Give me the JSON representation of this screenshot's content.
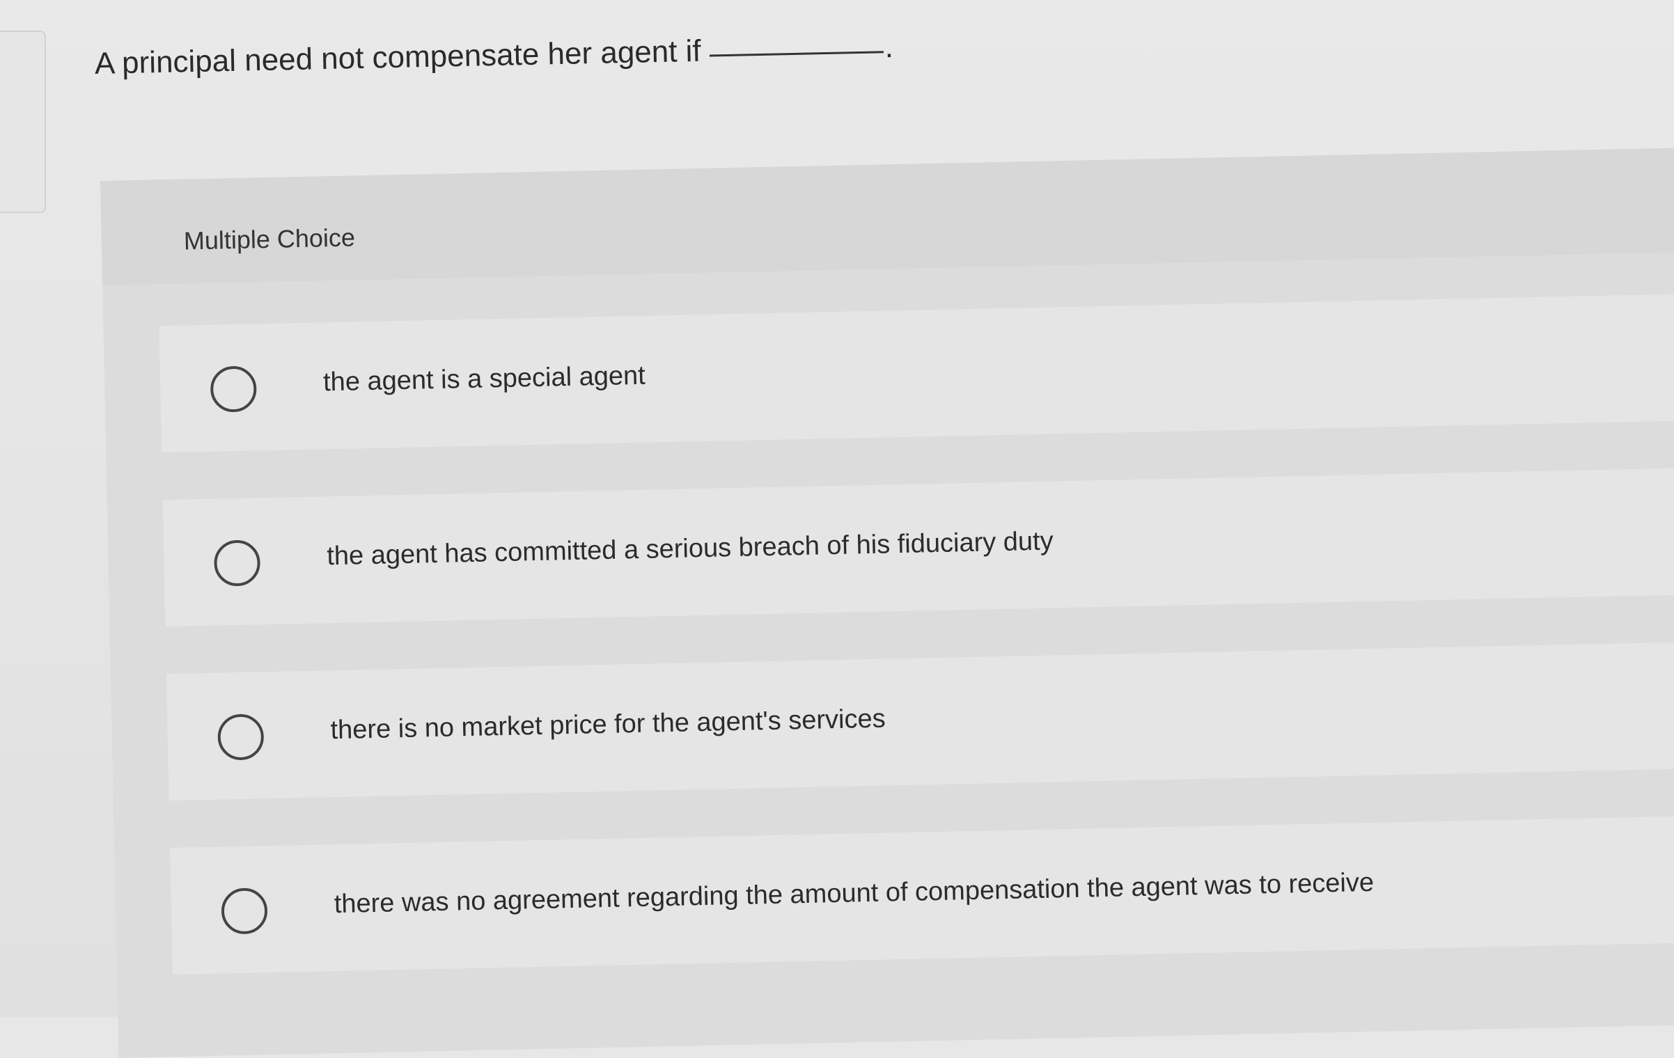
{
  "question": {
    "prompt": "A principal need not compensate her agent if",
    "period": "."
  },
  "section": {
    "title": "Multiple Choice"
  },
  "choices": [
    {
      "label": "the agent is a special agent"
    },
    {
      "label": "the agent has committed a serious breach of his fiduciary duty"
    },
    {
      "label": "there is no market price for the agent's services"
    },
    {
      "label": "there was no agreement regarding the amount of compensation the agent was to receive"
    }
  ],
  "colors": {
    "background": "#e7e7e7",
    "panel": "#dcdcdc",
    "choice_row": "#e5e5e5",
    "text": "#2b2b2b"
  }
}
